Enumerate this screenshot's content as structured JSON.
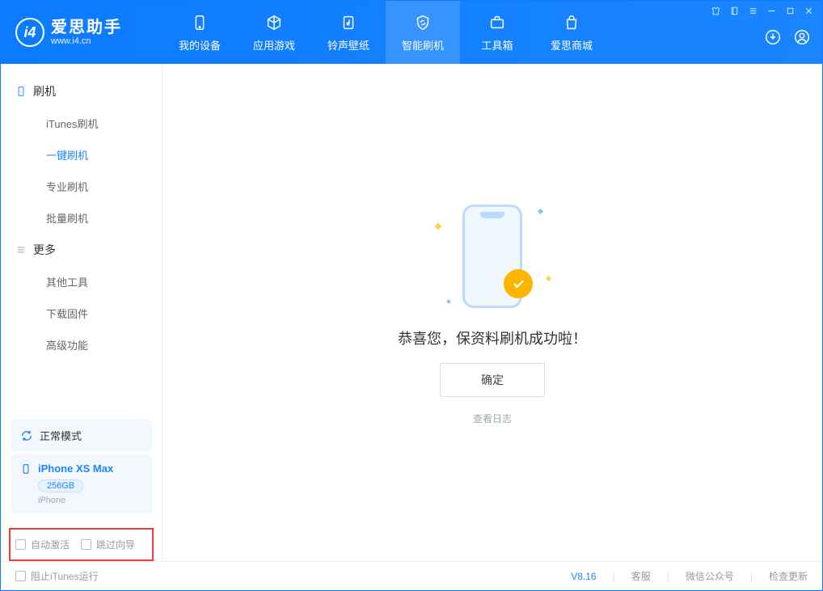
{
  "app": {
    "title": "爱思助手",
    "subtitle": "www.i4.cn"
  },
  "tabs": {
    "device": "我的设备",
    "apps": "应用游戏",
    "ringtone": "铃声壁纸",
    "flash": "智能刷机",
    "toolbox": "工具箱",
    "store": "爱思商城"
  },
  "sidebar": {
    "group_flash": "刷机",
    "items_flash": [
      "iTunes刷机",
      "一键刷机",
      "专业刷机",
      "批量刷机"
    ],
    "group_more": "更多",
    "items_more": [
      "其他工具",
      "下载固件",
      "高级功能"
    ]
  },
  "device": {
    "status": "正常模式",
    "name": "iPhone XS Max",
    "storage": "256GB",
    "type": "iPhone"
  },
  "checkboxes": {
    "auto_activate": "自动激活",
    "skip_guide": "跳过向导"
  },
  "main": {
    "success": "恭喜您，保资料刷机成功啦！",
    "confirm": "确定",
    "view_log": "查看日志"
  },
  "footer": {
    "block_itunes": "阻止iTunes运行",
    "version": "V8.16",
    "support": "客服",
    "wechat": "微信公众号",
    "update": "检查更新"
  }
}
